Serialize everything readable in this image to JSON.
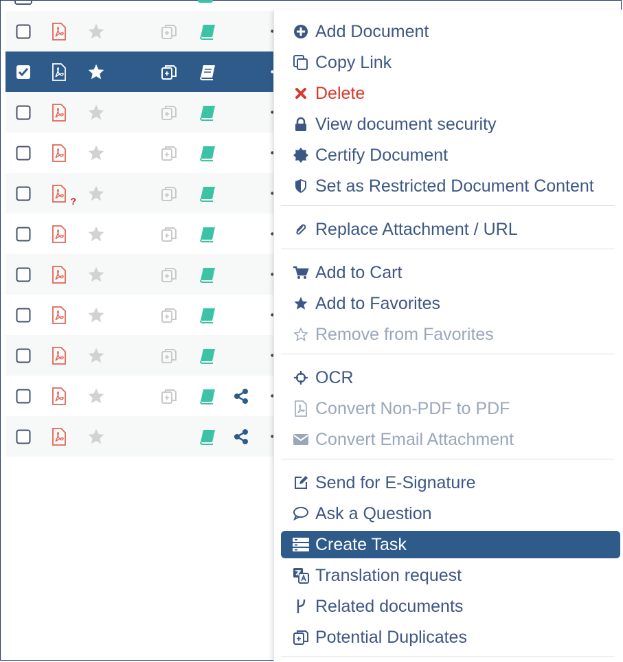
{
  "colors": {
    "accent": "#2f5b8b",
    "menu_text": "#3d5785",
    "delete_red": "#d63a2a",
    "disabled_text": "#9aa7bb",
    "pdf_red": "#e06655",
    "book_teal": "#3cc3a6",
    "star_gray": "#d2d2d2"
  },
  "menu": {
    "items": [
      {
        "label": "Add Document",
        "icon": "plus-circle-icon"
      },
      {
        "label": "Copy Link",
        "icon": "copy-icon"
      },
      {
        "label": "Delete",
        "icon": "x-icon",
        "style": "danger"
      },
      {
        "label": "View document security",
        "icon": "lock-icon"
      },
      {
        "label": "Certify Document",
        "icon": "certificate-icon"
      },
      {
        "label": "Set as Restricted Document Content",
        "icon": "shield-icon"
      },
      {
        "label": "Replace Attachment / URL",
        "icon": "paperclip-icon"
      },
      {
        "label": "Add to Cart",
        "icon": "cart-icon"
      },
      {
        "label": "Add to Favorites",
        "icon": "star-icon"
      },
      {
        "label": "Remove from Favorites",
        "icon": "star-outline-icon",
        "style": "disabled"
      },
      {
        "label": "OCR",
        "icon": "crosshair-icon"
      },
      {
        "label": "Convert Non-PDF to PDF",
        "icon": "pdf-file-icon",
        "style": "disabled"
      },
      {
        "label": "Convert Email Attachment",
        "icon": "envelope-icon",
        "style": "disabled"
      },
      {
        "label": "Send for E-Signature",
        "icon": "edit-icon"
      },
      {
        "label": "Ask a Question",
        "icon": "chat-bubble-icon"
      },
      {
        "label": "Create Task",
        "icon": "task-list-icon",
        "style": "active"
      },
      {
        "label": "Translation request",
        "icon": "translate-icon"
      },
      {
        "label": "Related documents",
        "icon": "branch-icon"
      },
      {
        "label": "Potential Duplicates",
        "icon": "duplicate-icon"
      }
    ]
  },
  "rows": [
    {
      "checked": false,
      "selected": false,
      "favorite": false,
      "pdf_unknown": false,
      "duplicates": true,
      "shared": false
    },
    {
      "checked": true,
      "selected": true,
      "favorite": true,
      "pdf_unknown": false,
      "duplicates": true,
      "shared": false
    },
    {
      "checked": false,
      "selected": false,
      "favorite": false,
      "pdf_unknown": false,
      "duplicates": true,
      "shared": false
    },
    {
      "checked": false,
      "selected": false,
      "favorite": false,
      "pdf_unknown": false,
      "duplicates": true,
      "shared": false
    },
    {
      "checked": false,
      "selected": false,
      "favorite": false,
      "pdf_unknown": true,
      "pdf_badge": "?",
      "duplicates": true,
      "shared": false
    },
    {
      "checked": false,
      "selected": false,
      "favorite": false,
      "pdf_unknown": false,
      "duplicates": true,
      "shared": false
    },
    {
      "checked": false,
      "selected": false,
      "favorite": false,
      "pdf_unknown": false,
      "duplicates": true,
      "shared": false
    },
    {
      "checked": false,
      "selected": false,
      "favorite": false,
      "pdf_unknown": false,
      "duplicates": true,
      "shared": false
    },
    {
      "checked": false,
      "selected": false,
      "favorite": false,
      "pdf_unknown": false,
      "duplicates": true,
      "shared": false
    },
    {
      "checked": false,
      "selected": false,
      "favorite": false,
      "pdf_unknown": false,
      "duplicates": true,
      "shared": true
    },
    {
      "checked": false,
      "selected": false,
      "favorite": false,
      "pdf_unknown": false,
      "duplicates": false,
      "shared": true
    }
  ]
}
